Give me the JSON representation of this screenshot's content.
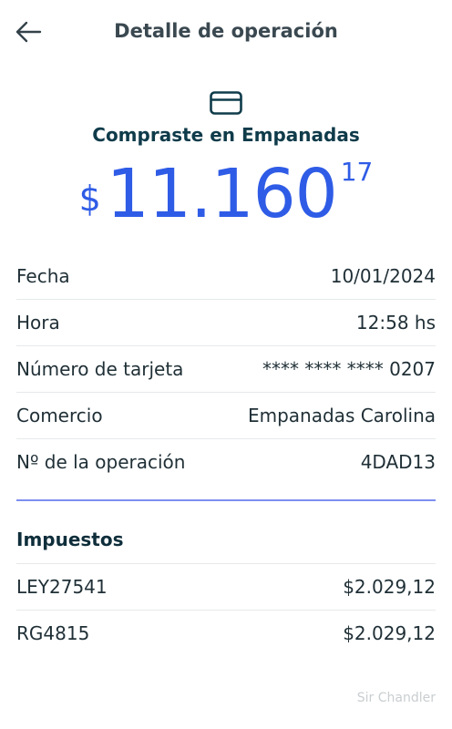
{
  "header": {
    "title": "Detalle de operación",
    "back_icon": "arrow-left-icon"
  },
  "summary": {
    "icon": "credit-card-icon",
    "title": "Compraste en Empanadas",
    "currency": "$",
    "amount_main": "11.160",
    "amount_cents": "17",
    "accent_color": "#2f5ce6"
  },
  "details": [
    {
      "label": "Fecha",
      "value": "10/01/2024"
    },
    {
      "label": "Hora",
      "value": "12:58 hs"
    },
    {
      "label": "Número de tarjeta",
      "value": "**** **** **** 0207"
    },
    {
      "label": "Comercio",
      "value": "Empanadas Carolina"
    },
    {
      "label": "Nº de la operación",
      "value": "4DAD13"
    }
  ],
  "taxes": {
    "title": "Impuestos",
    "items": [
      {
        "label": "LEY27541",
        "value": "$2.029,12"
      },
      {
        "label": "RG4815",
        "value": "$2.029,12"
      }
    ]
  },
  "watermark": "Sir Chandler"
}
